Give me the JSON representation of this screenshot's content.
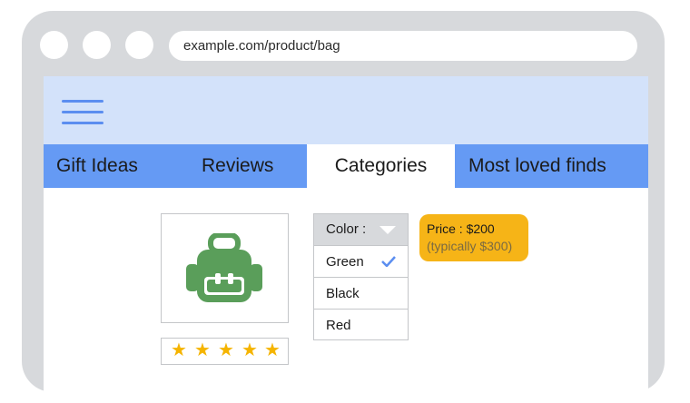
{
  "browser": {
    "url": "example.com/product/bag"
  },
  "header": {
    "menu_icon": "hamburger-menu-icon"
  },
  "nav": {
    "tabs": [
      {
        "label": "Gift Ideas"
      },
      {
        "label": "Reviews"
      },
      {
        "label": "Categories",
        "active": true
      },
      {
        "label": "Most loved finds"
      }
    ]
  },
  "product": {
    "icon": "backpack-icon",
    "rating_stars": 5
  },
  "color_select": {
    "label": "Color :",
    "options": [
      {
        "label": "Green",
        "selected": true
      },
      {
        "label": "Black"
      },
      {
        "label": "Red"
      }
    ]
  },
  "price": {
    "current": "Price : $200",
    "typical": "(typically $300)"
  },
  "colors": {
    "tab_bar": "#659af4",
    "header": "#d3e2fa",
    "accent": "#5b8ef0",
    "price_badge": "#f6b417",
    "star": "#f5b400",
    "bag": "#5a9e5a"
  }
}
